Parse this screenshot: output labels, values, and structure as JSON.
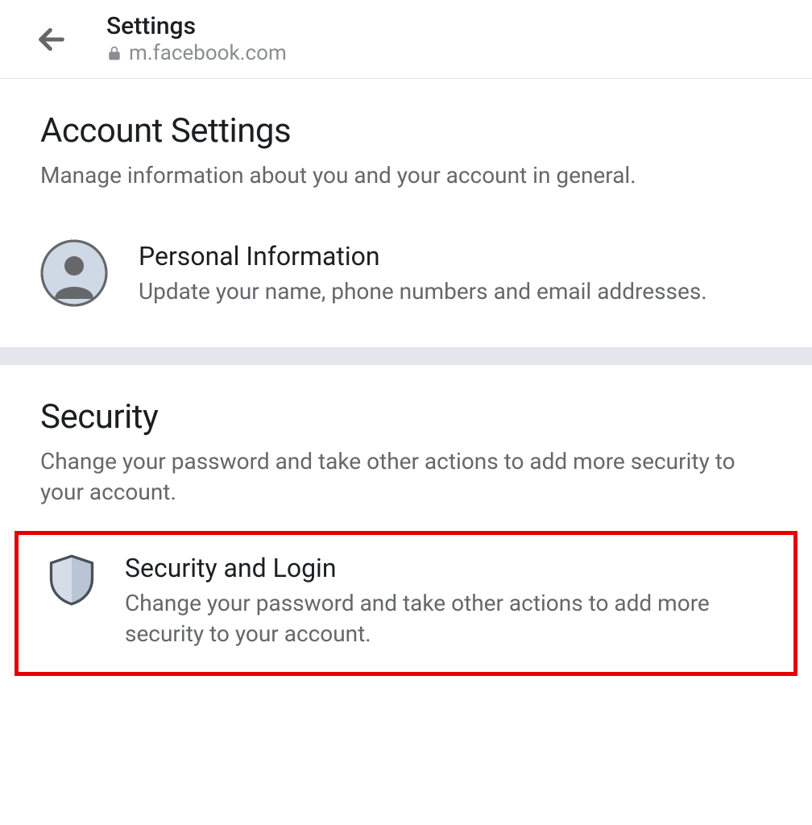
{
  "header": {
    "title": "Settings",
    "domain": "m.facebook.com"
  },
  "sections": {
    "account": {
      "title": "Account Settings",
      "description": "Manage information about you and your account in general.",
      "item": {
        "title": "Personal Information",
        "description": "Update your name, phone numbers and email addresses."
      }
    },
    "security": {
      "title": "Security",
      "description": "Change your password and take other actions to add more security to your account.",
      "item": {
        "title": "Security and Login",
        "description": "Change your password and take other actions to add more security to your account."
      }
    }
  }
}
